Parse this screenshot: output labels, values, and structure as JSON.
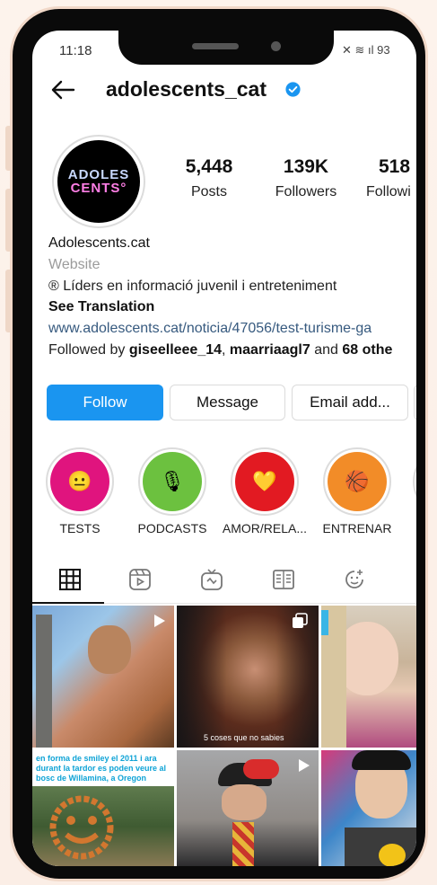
{
  "status_bar": {
    "time": "11:18",
    "right": "✕ ≋ ıl 93"
  },
  "header": {
    "username": "adolescents_cat"
  },
  "profile": {
    "logo_line1": "ADOLES",
    "logo_line2": "CENTS°",
    "stats": [
      {
        "value": "5,448",
        "label": "Posts"
      },
      {
        "value": "139K",
        "label": "Followers"
      },
      {
        "value": "518",
        "label": "Followi"
      }
    ],
    "name": "Adolescents.cat",
    "category": "Website",
    "description": "® Líders en informació juvenil i entreteniment",
    "see_translation": "See Translation",
    "link": "www.adolescents.cat/noticia/47056/test-turisme-ga",
    "followed_prefix": "Followed by ",
    "followed_user1": "giseelleee_14",
    "followed_sep": ", ",
    "followed_user2": "maarriaagl7",
    "followed_and": " and ",
    "followed_others": "68 othe"
  },
  "actions": {
    "follow": "Follow",
    "message": "Message",
    "email": "Email add..."
  },
  "highlights": [
    {
      "label": "TESTS",
      "emoji": "😐",
      "color": "#e0147e"
    },
    {
      "label": "PODCASTS",
      "emoji": "🎙",
      "color": "#6cc13f"
    },
    {
      "label": "AMOR/RELA...",
      "emoji": "💛",
      "color": "#e21a22"
    },
    {
      "label": "ENTRENAR",
      "emoji": "🏀",
      "color": "#f28c28"
    }
  ],
  "grid": {
    "tile2_caption": "5 coses que no sabies",
    "tile4_text": "en forma de smiley el 2011 i ara durant la tardor es poden veure al bosc de Willamina, a Oregon"
  },
  "colors": {
    "accent": "#1a95f0",
    "link": "#375a7f"
  }
}
